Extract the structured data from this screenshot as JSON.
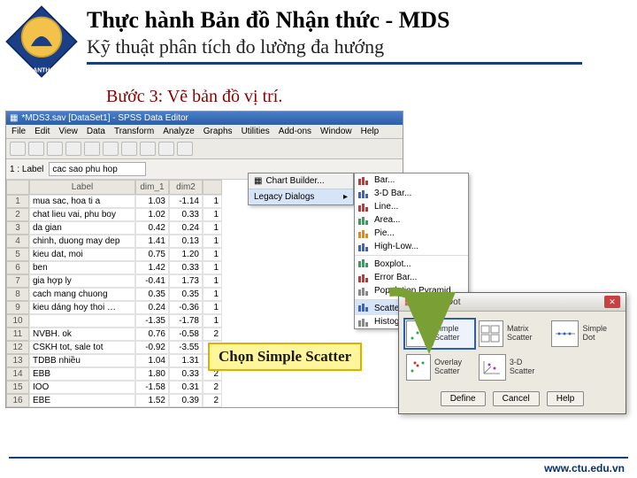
{
  "university": "CANTHO UNIVERSITY",
  "title": "Thực hành Bản đồ Nhận thức - MDS",
  "subtitle": "Kỹ thuật phân tích đo lường đa hướng",
  "step_label": "Bước 3: Vẽ bản đồ vị trí.",
  "spss": {
    "window_title": "*MDS3.sav [DataSet1] - SPSS Data Editor",
    "menus": [
      "File",
      "Edit",
      "View",
      "Data",
      "Transform",
      "Analyze",
      "Graphs",
      "Utilities",
      "Add-ons",
      "Window",
      "Help"
    ],
    "addr_label": "1 : Label",
    "addr_value": "cac sao phu hop",
    "columns": [
      "",
      "Label",
      "dim_1",
      "dim2",
      ""
    ],
    "rows": [
      [
        "1",
        "mua sac, hoa ti a",
        "1.03",
        "-1.14",
        "1"
      ],
      [
        "2",
        "chat lieu vai, phu boy",
        "1.02",
        "0.33",
        "1"
      ],
      [
        "3",
        "da gian",
        "0.42",
        "0.24",
        "1"
      ],
      [
        "4",
        "chinh, duong may dep",
        "1.41",
        "0.13",
        "1"
      ],
      [
        "5",
        "kieu dat, moi",
        "0.75",
        "1.20",
        "1"
      ],
      [
        "6",
        "ben",
        "1.42",
        "0.33",
        "1"
      ],
      [
        "7",
        "gia hợp ly",
        "-0.41",
        "1.73",
        "1"
      ],
      [
        "8",
        "cach mang chuong",
        "0.35",
        "0.35",
        "1"
      ],
      [
        "9",
        "kieu dáng hoy thoi …",
        "0.24",
        "-0.36",
        "1"
      ],
      [
        "10",
        "",
        "-1.35",
        "-1.78",
        "1"
      ],
      [
        "11",
        "NVBH. ok",
        "0.76",
        "-0.58",
        "2"
      ],
      [
        "12",
        "CSKH tot, sale tot",
        "-0.92",
        "-3.55",
        "2"
      ],
      [
        "13",
        "TDBB nhiều",
        "1.04",
        "1.31",
        "2"
      ],
      [
        "14",
        "EBB",
        "1.80",
        "0.33",
        "2"
      ],
      [
        "15",
        "IOO",
        "-1.58",
        "0.31",
        "2"
      ],
      [
        "16",
        "EBE",
        "1.52",
        "0.39",
        "2"
      ]
    ]
  },
  "submenu": {
    "header": "Chart Builder...",
    "item": "Legacy Dialogs"
  },
  "chart_menu": {
    "items": [
      "Bar...",
      "3-D Bar...",
      "Line...",
      "Area...",
      "Pie...",
      "High-Low...",
      "Boxplot...",
      "Error Bar...",
      "Population Pyramid...",
      "Scatter/Dot...",
      "Histogram..."
    ]
  },
  "callout": "Chọn Simple Scatter",
  "dialog": {
    "title": "Scatter/Dot",
    "options": [
      "Simple Scatter",
      "Matrix Scatter",
      "Simple Dot",
      "Overlay Scatter",
      "3-D Scatter"
    ],
    "buttons": [
      "Define",
      "Cancel",
      "Help"
    ]
  },
  "footer_url": "www.ctu.edu.vn"
}
